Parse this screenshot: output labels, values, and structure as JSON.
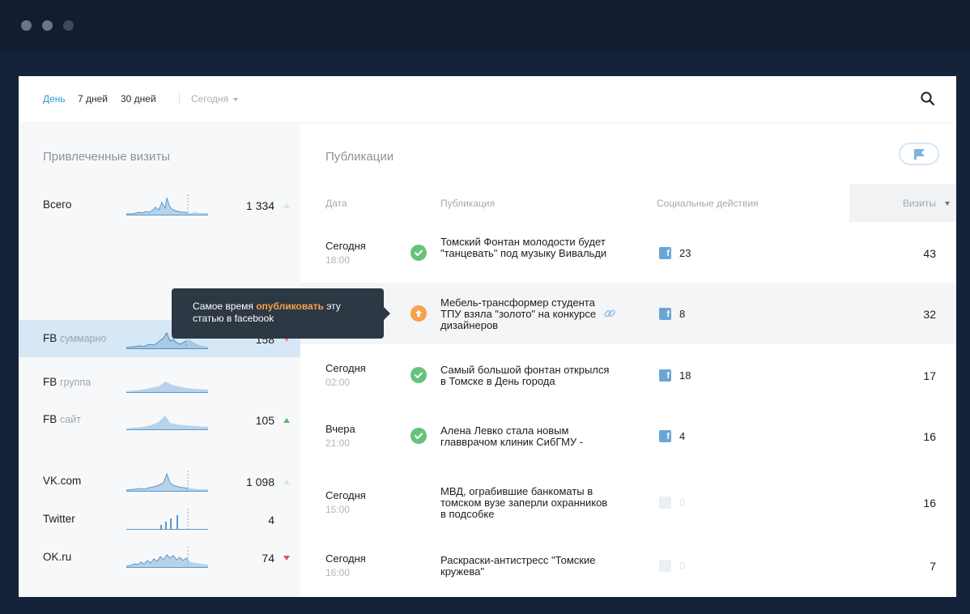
{
  "filters": {
    "periods": [
      "День",
      "7 дней",
      "30 дней"
    ],
    "active_period": "День",
    "date_select": "Сегодня"
  },
  "left_panel": {
    "title": "Привлеченные визиты",
    "sources": [
      {
        "name": "Всего",
        "sub": "",
        "value": "1 334",
        "trend": "up",
        "selected": false
      },
      {
        "name": "FB",
        "sub": "суммарно",
        "value": "158",
        "trend": "down",
        "selected": true
      },
      {
        "name": "FB",
        "sub": "группа",
        "value": "",
        "trend": "",
        "selected": false
      },
      {
        "name": "FB",
        "sub": "сайт",
        "value": "105",
        "trend": "up-strong",
        "selected": false
      },
      {
        "name": "VK.com",
        "sub": "",
        "value": "1 098",
        "trend": "up",
        "selected": false
      },
      {
        "name": "Twitter",
        "sub": "",
        "value": "4",
        "trend": "",
        "selected": false
      },
      {
        "name": "OK.ru",
        "sub": "",
        "value": "74",
        "trend": "down-strong",
        "selected": false
      }
    ]
  },
  "tooltip": {
    "text_before": "Самое время ",
    "highlight": "опубликовать",
    "text_after": " эту статью в facebook"
  },
  "publications": {
    "title": "Публикации",
    "columns": {
      "date": "Дата",
      "publication": "Публикация",
      "social": "Социальные действия",
      "visits": "Визиты"
    },
    "rows": [
      {
        "day": "Сегодня",
        "time": "18:00",
        "status": "ok",
        "title": "Томский Фонтан молодости будет \"танцевать\" под музыку Вивальди",
        "social": "23",
        "visits": "43",
        "social_faded": false,
        "highlight": false
      },
      {
        "day": "",
        "time": "",
        "status": "warn",
        "title": "Мебель-трансформер студента ТПУ взяла \"золото\" на конкурсе дизайнеров",
        "social": "8",
        "visits": "32",
        "social_faded": false,
        "highlight": true
      },
      {
        "day": "Сегодня",
        "time": "02:00",
        "status": "ok",
        "title": "Самый большой фонтан открылся в Томске в День города",
        "social": "18",
        "visits": "17",
        "social_faded": false,
        "highlight": false
      },
      {
        "day": "Вчера",
        "time": "21:00",
        "status": "ok",
        "title": "Алена Левко стала новым главврачом клиник СибГМУ -",
        "social": "4",
        "visits": "16",
        "social_faded": false,
        "highlight": false
      },
      {
        "day": "Сегодня",
        "time": "15:00",
        "status": "",
        "title": "МВД, ограбившие банкоматы в томском вузе заперли охранников в подсобке",
        "social": "0",
        "visits": "16",
        "social_faded": true,
        "highlight": false
      },
      {
        "day": "Сегодня",
        "time": "16:00",
        "status": "",
        "title": "Раскраски-антистресс \"Томские кружева\"",
        "social": "0",
        "visits": "7",
        "social_faded": true,
        "highlight": false
      }
    ]
  },
  "colors": {
    "accent": "#2f9ad6",
    "selected_row": "#d6e8f6",
    "ok": "#67c27c",
    "warn": "#f5a24c",
    "facebook": "#6aa6d5",
    "tooltip_bg": "#2c3844"
  },
  "icons": {
    "search": "search-icon",
    "flag": "flag-icon",
    "check": "check-icon",
    "alert": "alert-icon",
    "link": "link-icon",
    "facebook": "facebook-icon"
  }
}
